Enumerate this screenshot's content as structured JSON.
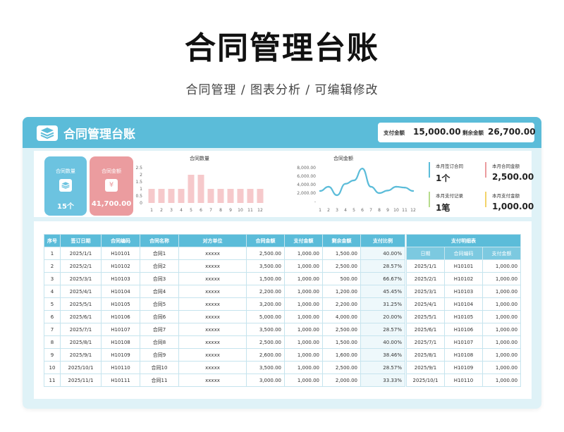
{
  "promo": {
    "title": "合同管理台账",
    "subtitle": "合同管理 / 图表分析 / 可编辑修改"
  },
  "app": {
    "title": "合同管理台账",
    "logo_icon": "stack-layers-icon",
    "header_stats": [
      {
        "label": "支付金额",
        "value": "15,000.00"
      },
      {
        "label": "剩余金额",
        "value": "26,700.00"
      }
    ]
  },
  "kpis": [
    {
      "label": "合同数量",
      "value": "15个",
      "icon": "stack-layers-icon",
      "color": "#6cc3e0"
    },
    {
      "label": "合同金额",
      "value": "41,700.00",
      "icon": "yen-icon",
      "glyph": "¥",
      "color": "#eb9c9f"
    }
  ],
  "month_stats": [
    {
      "label": "本月签订合同",
      "value": "1个",
      "color": "#5bbcd9"
    },
    {
      "label": "本月合同金额",
      "value": "2,500.00",
      "color": "#eb9c9f"
    },
    {
      "label": "本月支付记录",
      "value": "1笔",
      "color": "#b7dc8c"
    },
    {
      "label": "本月支付金额",
      "value": "1,000.00",
      "color": "#f3d36a"
    }
  ],
  "chart_data": [
    {
      "type": "bar",
      "title": "合同数量",
      "categories": [
        "1",
        "2",
        "3",
        "4",
        "5",
        "6",
        "7",
        "8",
        "9",
        "10",
        "11",
        "12"
      ],
      "values": [
        1,
        1,
        1,
        1,
        2,
        2,
        1,
        1,
        1,
        1,
        1,
        1
      ],
      "ylim": [
        0,
        2.5
      ],
      "yticks": [
        "2.5",
        "2",
        "1.5",
        "1",
        "0.5",
        "0"
      ],
      "color": "#f6c9cb"
    },
    {
      "type": "line",
      "title": "合同金额",
      "categories": [
        "1",
        "2",
        "3",
        "4",
        "5",
        "6",
        "7",
        "8",
        "9",
        "10",
        "11",
        "12"
      ],
      "values": [
        2500,
        3500,
        1500,
        4200,
        5000,
        7800,
        3500,
        2000,
        2600,
        3500,
        3300,
        2500
      ],
      "ylim": [
        0,
        8000
      ],
      "yticks": [
        "8,000.00",
        "6,000.00",
        "4,000.00",
        "2,000.00",
        "-"
      ],
      "color": "#5bbcd9"
    }
  ],
  "contracts": {
    "headers": [
      "序号",
      "签订日期",
      "合同编码",
      "合同名称",
      "对方单位",
      "合同金额",
      "支付金额",
      "剩余金额",
      "支付比例"
    ],
    "rows": [
      [
        "1",
        "2025/1/1",
        "H10101",
        "合同1",
        "xxxxx",
        "2,500.00",
        "1,000.00",
        "1,500.00",
        "40.00%"
      ],
      [
        "2",
        "2025/2/1",
        "H10102",
        "合同2",
        "xxxxx",
        "3,500.00",
        "1,000.00",
        "2,500.00",
        "28.57%"
      ],
      [
        "3",
        "2025/3/1",
        "H10103",
        "合同3",
        "xxxxx",
        "1,500.00",
        "1,000.00",
        "500.00",
        "66.67%"
      ],
      [
        "4",
        "2025/4/1",
        "H10104",
        "合同4",
        "xxxxx",
        "2,200.00",
        "1,000.00",
        "1,200.00",
        "45.45%"
      ],
      [
        "5",
        "2025/5/1",
        "H10105",
        "合同5",
        "xxxxx",
        "3,200.00",
        "1,000.00",
        "2,200.00",
        "31.25%"
      ],
      [
        "6",
        "2025/6/1",
        "H10106",
        "合同6",
        "xxxxx",
        "5,000.00",
        "1,000.00",
        "4,000.00",
        "20.00%"
      ],
      [
        "7",
        "2025/7/1",
        "H10107",
        "合同7",
        "xxxxx",
        "3,500.00",
        "1,000.00",
        "2,500.00",
        "28.57%"
      ],
      [
        "8",
        "2025/8/1",
        "H10108",
        "合同8",
        "xxxxx",
        "2,500.00",
        "1,000.00",
        "1,500.00",
        "40.00%"
      ],
      [
        "9",
        "2025/9/1",
        "H10109",
        "合同9",
        "xxxxx",
        "2,600.00",
        "1,000.00",
        "1,600.00",
        "38.46%"
      ],
      [
        "10",
        "2025/10/1",
        "H10110",
        "合同10",
        "xxxxx",
        "3,500.00",
        "1,000.00",
        "2,500.00",
        "28.57%"
      ],
      [
        "11",
        "2025/11/1",
        "H10111",
        "合同11",
        "xxxxx",
        "3,000.00",
        "1,000.00",
        "2,000.00",
        "33.33%"
      ]
    ]
  },
  "payments": {
    "title": "支付明细表",
    "headers": [
      "日期",
      "合同编码",
      "支付金额"
    ],
    "rows": [
      [
        "2025/1/1",
        "H10101",
        "1,000.00"
      ],
      [
        "2025/2/1",
        "H10102",
        "1,000.00"
      ],
      [
        "2025/3/1",
        "H10103",
        "1,000.00"
      ],
      [
        "2025/4/1",
        "H10104",
        "1,000.00"
      ],
      [
        "2025/5/1",
        "H10105",
        "1,000.00"
      ],
      [
        "2025/6/1",
        "H10106",
        "1,000.00"
      ],
      [
        "2025/7/1",
        "H10107",
        "1,000.00"
      ],
      [
        "2025/8/1",
        "H10108",
        "1,000.00"
      ],
      [
        "2025/9/1",
        "H10109",
        "1,000.00"
      ],
      [
        "2025/10/1",
        "H10110",
        "1,000.00"
      ]
    ]
  }
}
